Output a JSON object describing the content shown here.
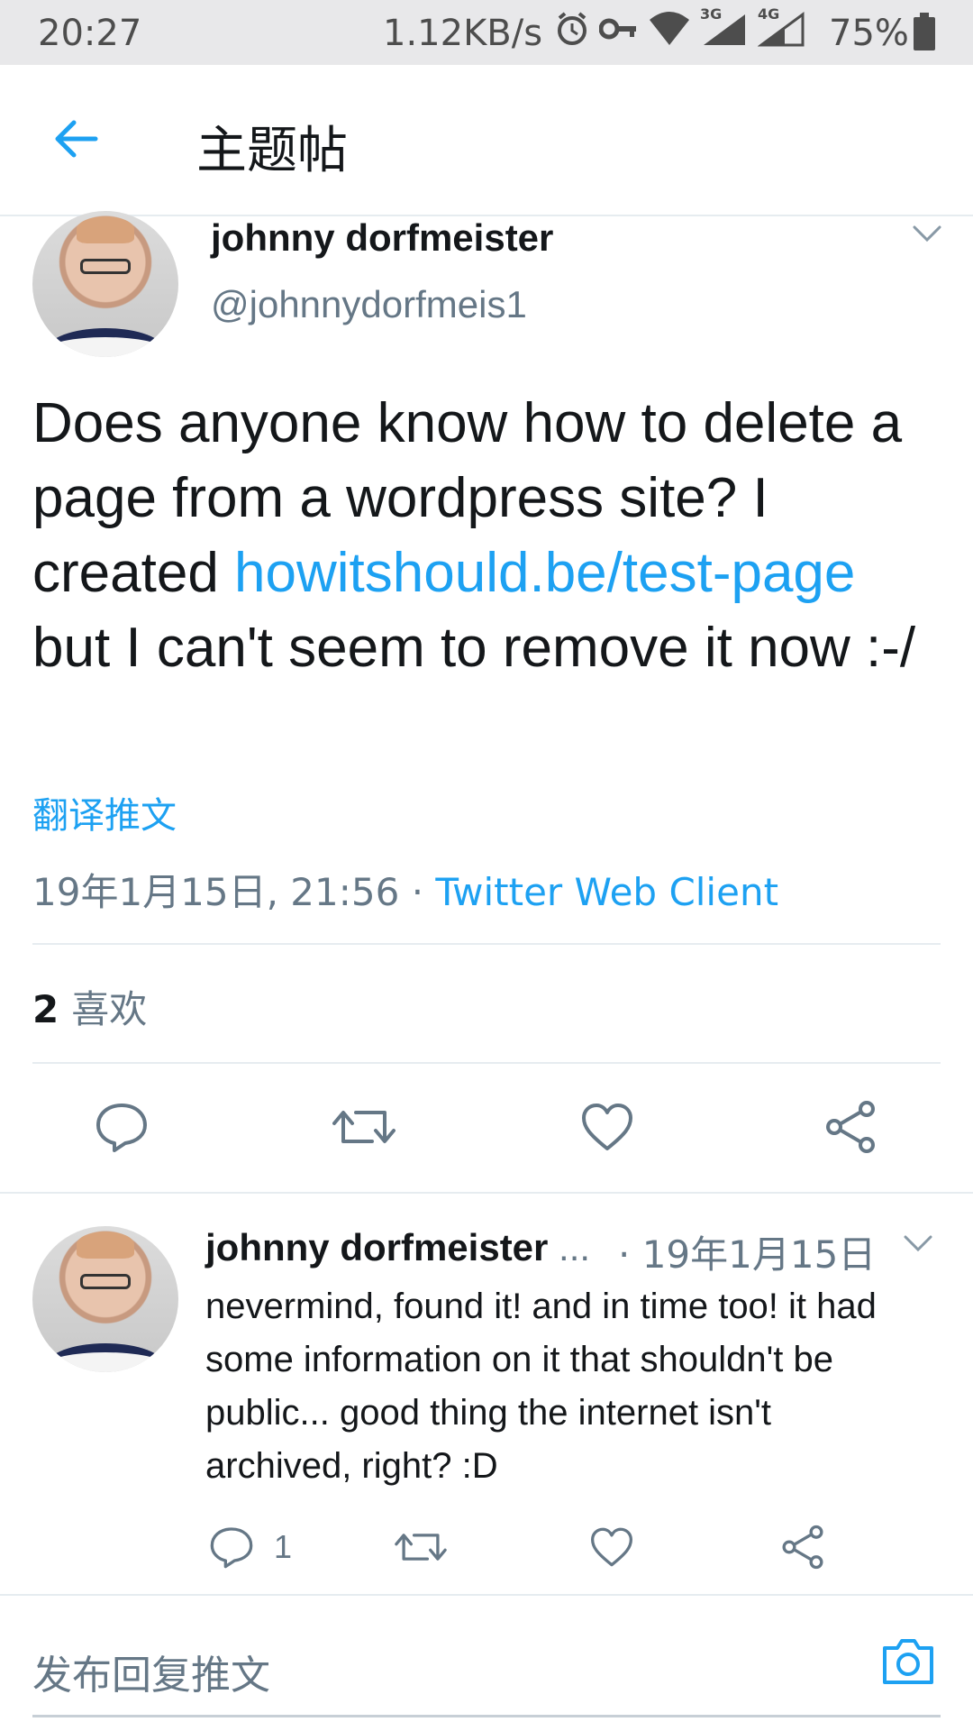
{
  "status_bar": {
    "time": "20:27",
    "network_speed": "1.12KB/s",
    "net_3g": "3G",
    "net_4g": "4G",
    "battery": "75%"
  },
  "app_bar": {
    "title": "主题帖"
  },
  "tweet": {
    "author_name": "johnny dorfmeister",
    "author_handle": "@johnnydorfmeis1",
    "text_before_link": "Does anyone know how to delete a page from a wordpress site? I created ",
    "link": "howitshould.be/test-page",
    "text_after_link": " but I can't seem to remove it now :-/",
    "translate_label": "翻译推文",
    "datetime": "19年1月15日, 21:56 · ",
    "client": "Twitter Web Client",
    "like_count": "2",
    "like_label": "喜欢"
  },
  "reply": {
    "author_name": "johnny dorfmeister",
    "ellipsis": " ...",
    "date": "· 19年1月15日",
    "text": "nevermind, found it! and in time too! it had some information on it that shouldn't be public... good thing the internet isn't archived, right? :D",
    "reply_count": "1"
  },
  "composer": {
    "placeholder": "发布回复推文"
  },
  "colors": {
    "accent": "#1da1f2",
    "secondary_text": "#657786",
    "divider": "#e6ecf0"
  }
}
